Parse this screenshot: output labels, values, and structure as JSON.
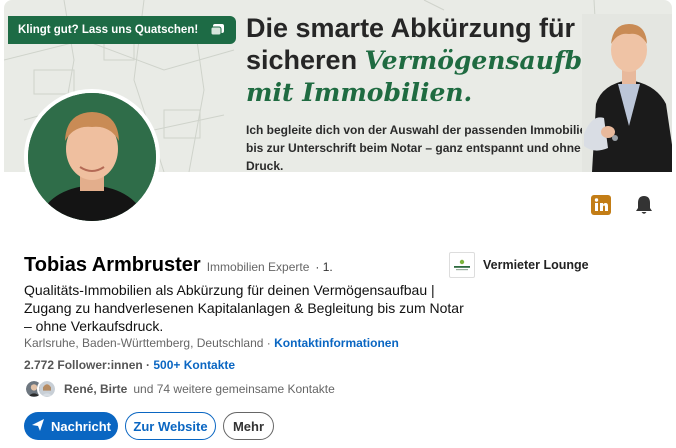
{
  "banner": {
    "chip_text": "Klingt gut? Lass uns Quatschen!",
    "headline_line1": "Die smarte Abkürzung für",
    "headline_line2_plain": "sicheren ",
    "headline_line2_accent": "Vermögensaufbau",
    "headline_line3": "mit Immobilien.",
    "subtext": "Ich begleite dich von der Auswahl der passenden Immobilie bis zur Unterschrift beim Notar – ganz entspannt und ohne Druck."
  },
  "profile": {
    "name": "Tobias Armbruster",
    "role": "Immobilien Experte",
    "degree": "· 1.",
    "headline": "Qualitäts-Immobilien als Abkürzung  für deinen Vermögensaufbau | Zugang zu handverlesenen Kapitalanlagen & Begleitung bis zum Notar – ohne Verkaufsdruck.",
    "location": "Karlsruhe, Baden-Württemberg, Deutschland",
    "location_sep": " · ",
    "contact_info": "Kontaktinformationen",
    "followers": "2.772 Follower:innen",
    "followers_sep": " · ",
    "contacts": "500+ Kontakte",
    "mutual_names": "René, Birte",
    "mutual_rest": "und 74 weitere gemeinsame Kontakte"
  },
  "company": {
    "name": "Vermieter Lounge"
  },
  "actions": {
    "message": "Nachricht",
    "website": "Zur Website",
    "more": "Mehr"
  },
  "icons": {
    "linkedin": "linkedin-icon",
    "bell": "bell-icon",
    "send": "send-icon",
    "chip": "chat-icon"
  },
  "colors": {
    "accent_blue": "#0a66c2",
    "banner_green": "#1d6b45",
    "linkedin_orange": "#c37d16"
  }
}
